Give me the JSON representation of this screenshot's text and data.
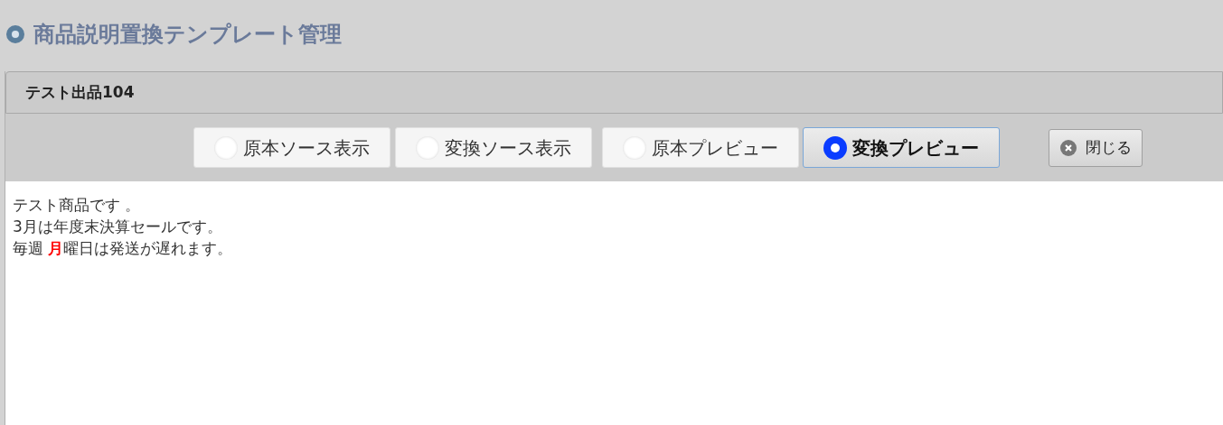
{
  "page_title": "商品説明置換テンプレート管理",
  "panel": {
    "title": "テスト出品104",
    "view_options": [
      {
        "label": "原本ソース表示",
        "selected": false
      },
      {
        "label": "変換ソース表示",
        "selected": false
      },
      {
        "label": "原本プレビュー",
        "selected": false
      },
      {
        "label": "変換プレビュー",
        "selected": true
      }
    ],
    "close_button": "閉じる",
    "preview_lines": [
      "テスト商品です 。",
      "3月は年度末決算セールです。",
      "毎週 **月**曜日は発送が遅れます。"
    ]
  }
}
